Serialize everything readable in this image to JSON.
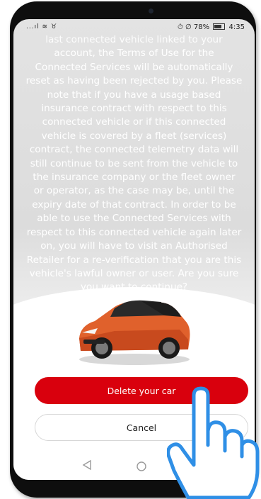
{
  "status_bar": {
    "left_icons": "...ıl ≋ ♉",
    "right_text": "⏱ ∅ 78% ▭ 4:35",
    "battery_percent": "78%",
    "time": "4:35"
  },
  "message": {
    "lines": [
      "last connected vehicle linked to your",
      "account, the Terms of Use for the",
      "Connected Services will be automatically",
      "reset as having been rejected by you. Please",
      "note that if you have a usage based",
      "insurance contract with respect to this",
      "connected vehicle or if this connected",
      "vehicle is covered by a fleet (services)",
      "contract, the connected telemetry data will",
      "still continue to be sent from the vehicle to",
      "the insurance company or the fleet owner",
      "or operator, as the case may be, until the",
      "expiry date of that contract. In order to be",
      "able to use the Connected Services with",
      "respect to this connected vehicle again later",
      "on, you will have to visit an Authorised",
      "Retailer for a re-verification that you are this",
      "vehicle's lawful owner or user. Are you sure",
      "you want to continue?"
    ]
  },
  "actions": {
    "delete_label": "Delete your car",
    "cancel_label": "Cancel"
  },
  "colors": {
    "primary": "#d9000d",
    "car_body": "#e0612c"
  },
  "icons": {
    "nav_back": "triangle-back-icon",
    "nav_home": "circle-home-icon",
    "pointer": "tapping-hand-icon"
  }
}
